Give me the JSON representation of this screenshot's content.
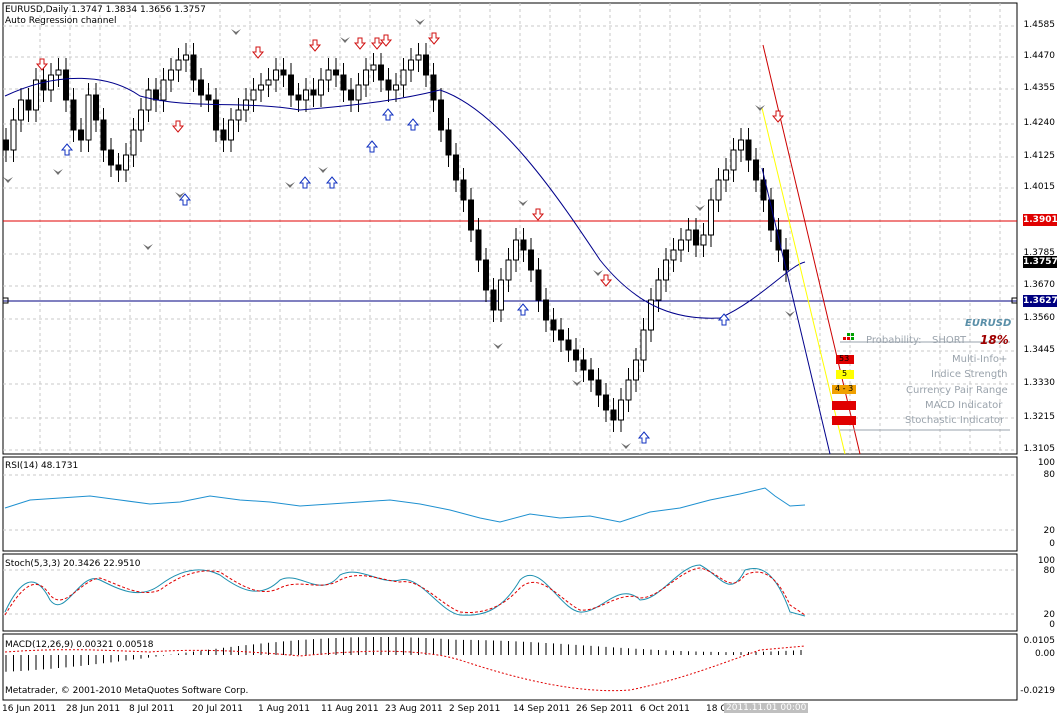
{
  "main": {
    "symbol_line": "EURUSD,Daily  1.3747 1.3834 1.3656 1.3757",
    "indicator_name": "Auto Regression channel",
    "price_levels": [
      "1.4585",
      "1.4470",
      "1.4355",
      "1.4240",
      "1.4125",
      "1.4015",
      "1.3785",
      "1.3670",
      "1.3560",
      "1.3445",
      "1.3330",
      "1.3215",
      "1.3105"
    ],
    "tags": [
      {
        "value": "1.3901",
        "color": "#e00000"
      },
      {
        "value": "1.3757",
        "color": "#000000"
      },
      {
        "value": "1.3627",
        "color": "#000080"
      }
    ]
  },
  "panel": {
    "pair": "EURUSD",
    "probability_label": "Probability:",
    "direction": "SHORT",
    "percent": "18%",
    "rows": [
      {
        "chip": "53",
        "label": "Multi-Info+",
        "color": "#e00000"
      },
      {
        "chip": "5",
        "label": "Indice Strength",
        "color": "#ffff00"
      },
      {
        "chip": "4 - 3",
        "label": "Currency Pair Range",
        "color": "#f0a000"
      },
      {
        "chip": "",
        "label": "MACD Indicator",
        "color": "#e00000"
      },
      {
        "chip": "",
        "label": "Stochastic Indicator",
        "color": "#e00000"
      }
    ]
  },
  "rsi": {
    "label": "RSI(14) 48.1731",
    "levels": [
      "100",
      "80",
      "20",
      "0"
    ]
  },
  "stoch": {
    "label": "Stoch(5,3,3) 20.3426 22.9510",
    "levels": [
      "100",
      "80",
      "20",
      "0"
    ]
  },
  "macd": {
    "label": "MACD(12,26,9) 0.00321 0.00518",
    "levels": [
      "0.0105",
      "0.00",
      "-0.0219"
    ]
  },
  "copyright": "Metatrader, © 2001-2010 MetaQuotes Software Corp.",
  "x_axis": [
    "16 Jun 2011",
    "28 Jun 2011",
    "8 Jul 2011",
    "20 Jul 2011",
    "1 Aug 2011",
    "11 Aug 2011",
    "23 Aug 2011",
    "2 Sep 2011",
    "14 Sep 2011",
    "26 Sep 2011",
    "6 Oct 2011",
    "18 Oct 2011"
  ],
  "x_axis_current": "2011.11.01 00:00",
  "colors": {
    "ma": "#00008b",
    "channel_red": "#e00000",
    "channel_yellow": "#ffff00",
    "rsi_line": "#1e90d0",
    "stoch_main": "#1e90b0",
    "stoch_signal": "#e00000"
  }
}
